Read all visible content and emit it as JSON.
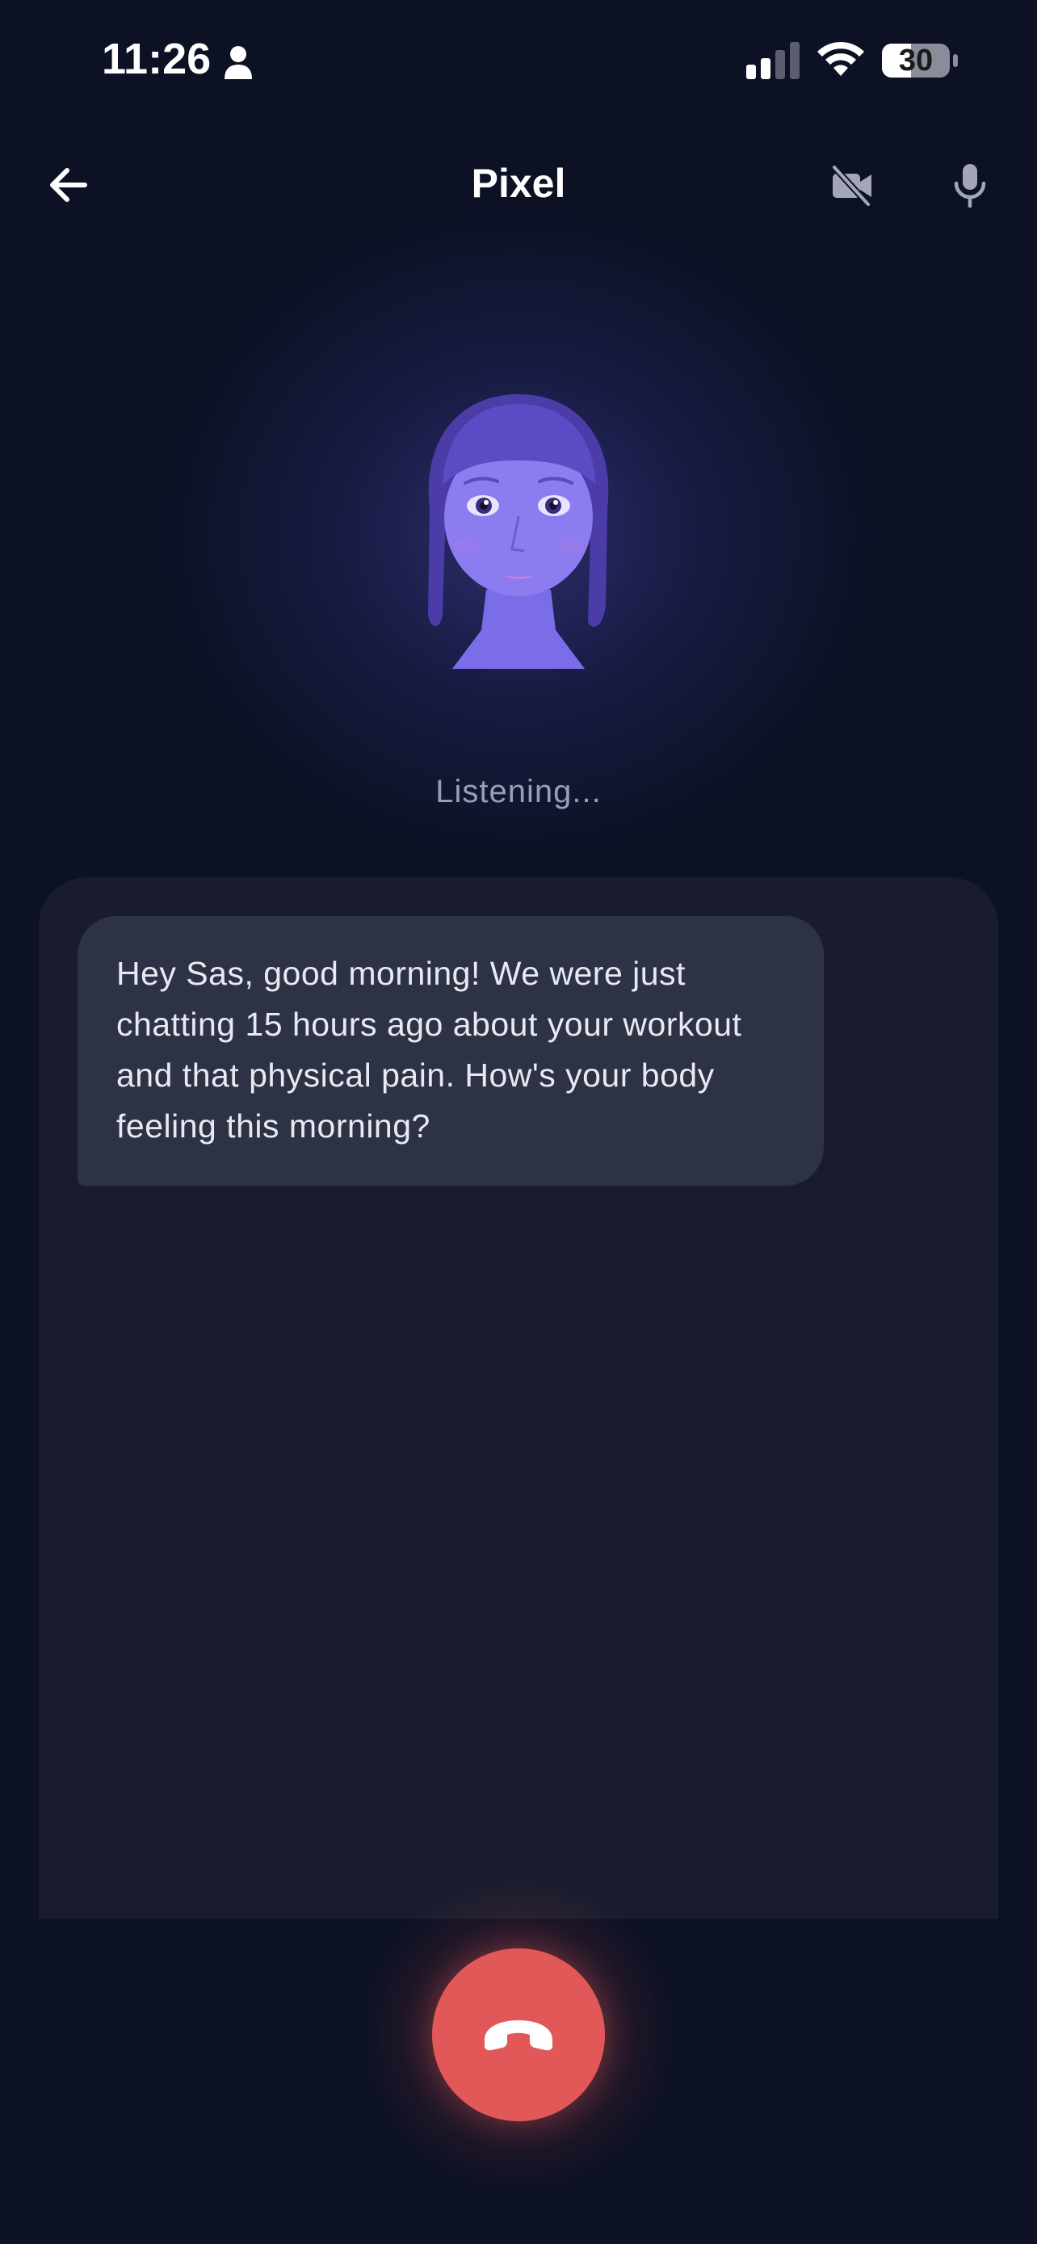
{
  "status_bar": {
    "time": "11:26",
    "battery": "30"
  },
  "header": {
    "title": "Pixel"
  },
  "status_text": "Listening...",
  "messages": [
    {
      "sender": "Pixel",
      "text": "Hey Sas, good morning! We were just chatting 15 hours ago about your workout and that physical pain. How's your body feeling this morning?"
    }
  ],
  "colors": {
    "background": "#0c1124",
    "panel": "#181c2e",
    "bubble": "#2e3245",
    "accent_avatar": "#7a6ae6",
    "end_call": "#e25858"
  },
  "icons": {
    "back": "arrow-left-icon",
    "video_off": "video-off-icon",
    "mic": "mic-icon",
    "end_call": "phone-hangup-icon"
  }
}
